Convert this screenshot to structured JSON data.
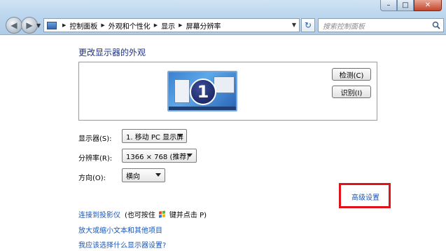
{
  "window": {
    "caption": {
      "minimize": "–",
      "maximize": "□",
      "close": "✕"
    }
  },
  "nav": {
    "back_icon": "back-arrow-icon",
    "forward_icon": "forward-arrow-icon",
    "breadcrumbs": [
      "控制面板",
      "外观和个性化",
      "显示",
      "屏幕分辨率"
    ],
    "search_placeholder": "搜索控制面板"
  },
  "main": {
    "heading": "更改显示器的外观",
    "monitor_number": "1",
    "detect_button": "检测(C)",
    "identify_button": "识别(I)",
    "display_label": "显示器(S):",
    "display_value": "1. 移动 PC 显示屏",
    "resolution_label": "分辨率(R):",
    "resolution_value": "1366 × 768 (推荐)",
    "orientation_label": "方向(O):",
    "orientation_value": "横向",
    "advanced_link": "高级设置",
    "highlight_color": "#e2121a"
  },
  "links": {
    "projector_link": "连接到投影仪",
    "projector_hint_1": "(也可按住",
    "projector_hint_2": "键并点击 P)",
    "text_size_link": "放大或缩小文本和其他项目",
    "which_settings_link": "我应该选择什么显示器设置?"
  }
}
